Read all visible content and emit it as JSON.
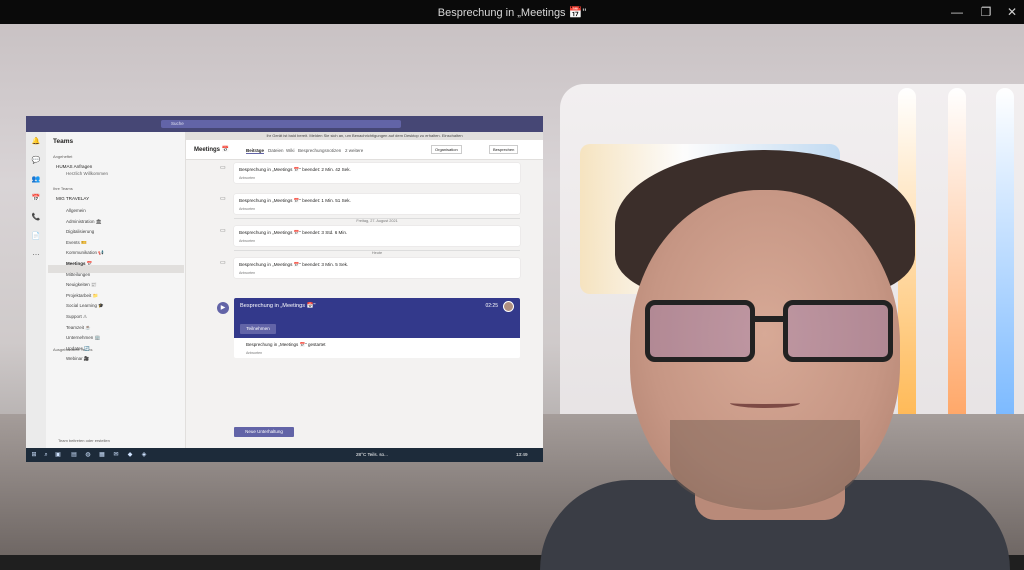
{
  "window": {
    "title": "Besprechung in „Meetings 📅\"",
    "min_glyph": "—",
    "max_glyph": "❐",
    "close_glyph": "✕"
  },
  "teams": {
    "search_placeholder": "Suche",
    "left_panel": {
      "title": "Teams",
      "pinned_label": "Angeheftet",
      "pinned_team": "HUMAS Anfragen",
      "pinned_channel": "Herzlich Willkommen",
      "your_teams_label": "Ihre Teams",
      "team_name": "MIG TRAVELAY",
      "channels": [
        "Allgemein",
        "Administration 🏛",
        "Digitalisierung",
        "Events 🎫",
        "Kommunikation 📢",
        "Meetings 📅",
        "Mitteilungen",
        "Neuigkeiten 📰",
        "Projektarbeit 📁",
        "Social Learning 🎓",
        "Support ⚠",
        "Teamzeit ☕",
        "Unternehmen 🏢",
        "Updates 🔄",
        "Webinar 🎥"
      ],
      "hidden_teams_label": "Ausgeblendete Teams",
      "join_create": "Team beitreten oder erstellen"
    },
    "notice": "Ihr Gerät ist bald bereit. Melden Sie sich an, um Benachrichtigungen auf dem Desktop zu erhalten. Einschalten",
    "channel": {
      "title": "Meetings 📅",
      "tabs": [
        "Beiträge",
        "Dateien",
        "Wiki",
        "Besprechungsnotizen",
        "2 weitere"
      ],
      "active_tab": "Beiträge",
      "org_btn": "Organisation",
      "meet_btn": "Besprechen"
    },
    "messages": [
      {
        "text": "Besprechung in „Meetings 📅\" beendet: 2 Min. 42 Sek.",
        "reply": "Antworten"
      },
      {
        "text": "Besprechung in „Meetings 📅\" beendet: 1 Min. 51 Sek.",
        "reply": "Antworten"
      },
      {
        "text": "Besprechung in „Meetings 📅\" beendet: 3 Std. 6 Min.",
        "reply": "Antworten"
      },
      {
        "text": "Besprechung in „Meetings 📅\" beendet: 3 Min. 5 Sek.",
        "reply": "Antworten"
      }
    ],
    "date_divider_1": "Freitag, 27. August 2021",
    "date_divider_2": "Heute",
    "live_meeting": {
      "title": "Besprechung in „Meetings 📅\"",
      "time": "02:25",
      "join_label": "Teilnehmen",
      "started_text": "Besprechung in „Meetings 📅\" gestartet",
      "reply": "Antworten"
    },
    "new_conversation": "Neue Unterhaltung",
    "taskbar": {
      "weather": "28°C Teils. so...",
      "clock": "13:49"
    }
  },
  "colors": {
    "teams_purple": "#464775",
    "accent": "#6264a7",
    "meeting_banner": "#33398b"
  }
}
